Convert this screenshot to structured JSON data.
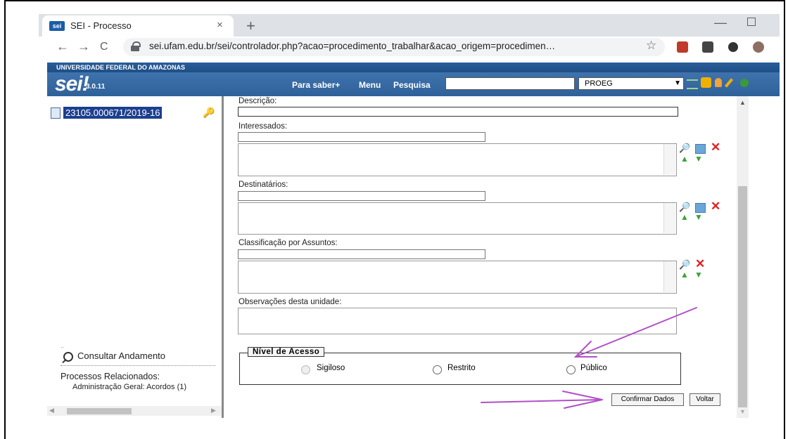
{
  "browser": {
    "tab_title": "SEI - Processo",
    "tab_close": "×",
    "new_tab": "+",
    "favicon_text": "sei",
    "url": "sei.ufam.edu.br/sei/controlador.php?acao=procedimento_trabalhar&acao_origem=procedimen…",
    "nav_back": "←",
    "nav_forward": "→",
    "nav_reload": "C",
    "bookmark_star": "☆",
    "win_minimize": "—"
  },
  "sei": {
    "university": "UNIVERSIDADE FEDERAL DO AMAZONAS",
    "logo": "sei!",
    "version": "3.0.11",
    "links": {
      "para_saber": "Para saber+",
      "menu": "Menu",
      "pesquisa": "Pesquisa"
    },
    "unit": "PROEG",
    "unit_arrow": "▼"
  },
  "left": {
    "process_number": "23105.000671/2019-16",
    "consultar": "Consultar Andamento",
    "related_title": "Processos Relacionados:",
    "related_item": "Administração Geral: Acordos (1)"
  },
  "form": {
    "descricao": "Descrição:",
    "interessados": "Interessados:",
    "destinatarios": "Destinatários:",
    "classificacao": "Classificação por Assuntos:",
    "observacoes": "Observações desta unidade:",
    "nivel_acesso": "Nível de Acesso",
    "radios": {
      "sigiloso": "Sigiloso",
      "restrito": "Restrito",
      "publico": "Público"
    },
    "confirm_button": "Confirmar Dados",
    "back_button": "Voltar"
  },
  "colors": {
    "sei_blue": "#2f6199",
    "selection_blue": "#1c3f8f",
    "annotation_arrow": "#b24fc8"
  }
}
